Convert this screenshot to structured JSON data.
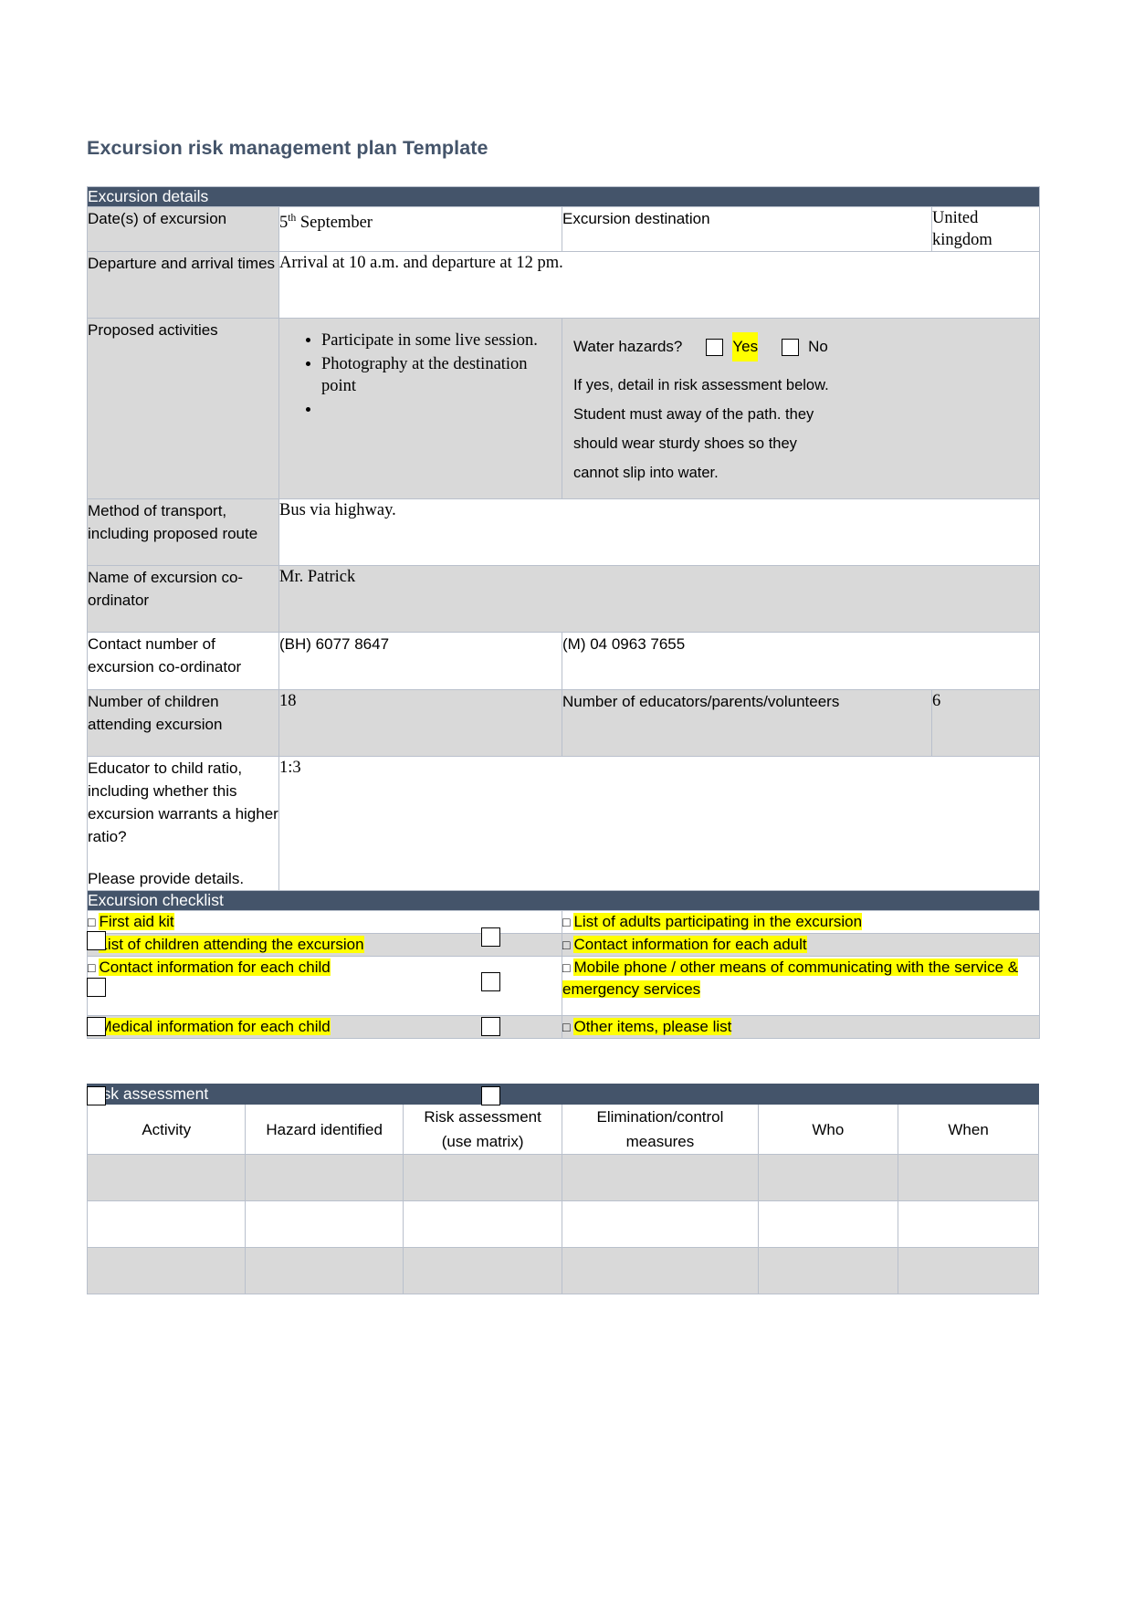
{
  "document": {
    "title": "Excursion risk management plan Template"
  },
  "excursion_details": {
    "section_title": "Excursion details",
    "rows": {
      "dates_label": "Date(s) of excursion",
      "dates_value_main": "5",
      "dates_value_sup": "th",
      "dates_value_rest": " September",
      "destination_label": "Excursion destination",
      "destination_value": "United kingdom",
      "times_label": "Departure and arrival times",
      "times_value": "Arrival at 10 a.m. and departure at 12 pm.",
      "activities_label": "Proposed activities",
      "activities": [
        "Participate in some live session.",
        "Photography at the destination point",
        ""
      ],
      "water_question": "Water hazards?",
      "water_yes": "Yes",
      "water_no": "No",
      "water_note": "If yes, detail in risk assessment below.",
      "water_detail_1": "Student must away of the path. they",
      "water_detail_2": "should wear sturdy shoes so they",
      "water_detail_3": "cannot slip into water.",
      "transport_label": "Method of transport, including proposed route",
      "transport_value": "Bus via highway.",
      "coordinator_label": "Name of excursion co-ordinator",
      "coordinator_value": "Mr. Patrick",
      "contact_label": "Contact number of excursion co-ordinator",
      "contact_bh": "(BH) 6077 8647",
      "contact_m": "(M) 04 0963 7655",
      "children_label": "Number of children attending excursion",
      "children_value": "18",
      "educators_label": "Number of educators/parents/volunteers",
      "educators_value": "6",
      "ratio_label_1": "Educator to child ratio, including whether this excursion warrants a higher ratio?",
      "ratio_label_2": "Please provide details.",
      "ratio_value": "1:3"
    }
  },
  "checklist": {
    "section_title": "Excursion checklist",
    "items": [
      {
        "text": "First aid kit",
        "col": "left"
      },
      {
        "text": "List of adults participating in the excursion",
        "col": "right"
      },
      {
        "text": "List of children attending the excursion",
        "col": "left"
      },
      {
        "text": "Contact information for each adult",
        "col": "right"
      },
      {
        "text": "Contact information for each child",
        "col": "left"
      },
      {
        "text": "Mobile phone / other means of communicating with the service & emergency services",
        "col": "right"
      },
      {
        "text": "Medical information for each child",
        "col": "left"
      },
      {
        "text": "Other items, please list",
        "col": "right"
      }
    ],
    "box_glyph": "□"
  },
  "risk_assessment": {
    "section_title": "Risk assessment",
    "columns": [
      {
        "line1": "Activity",
        "line2": ""
      },
      {
        "line1": "Hazard identified",
        "line2": ""
      },
      {
        "line1": "Risk assessment",
        "line2": "(use matrix)"
      },
      {
        "line1": "Elimination/control",
        "line2": "measures"
      },
      {
        "line1": "Who",
        "line2": ""
      },
      {
        "line1": "When",
        "line2": ""
      }
    ],
    "empty_rows": 3
  },
  "colors": {
    "header_bg": "#44546a",
    "label_bg": "#d9d9d9",
    "highlight": "#ffff00",
    "border": "#b9c0cc"
  }
}
